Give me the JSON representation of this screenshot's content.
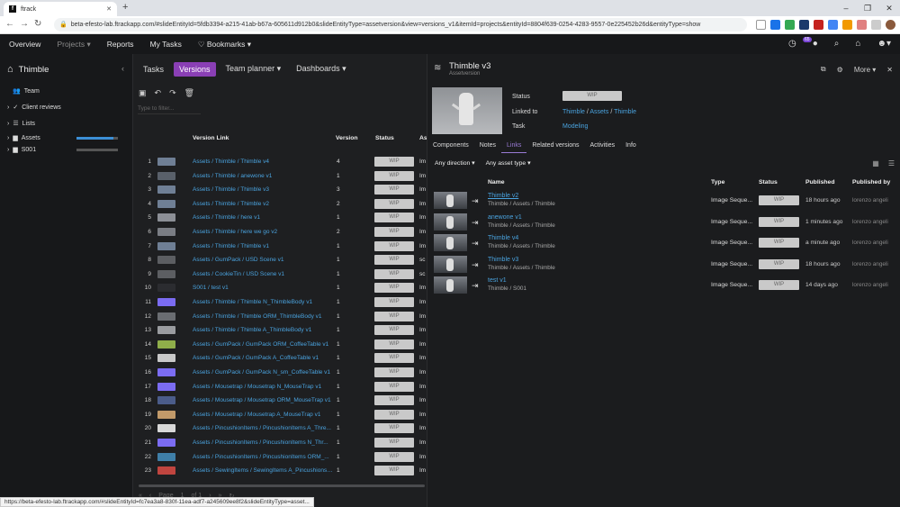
{
  "browser": {
    "tab_title": "ftrack",
    "url": "beta-efesto-lab.ftrackapp.com/#slideEntityId=5fdb3394-a215-41ab-b67a-605611d912b0&slideEntityType=assetversion&view=versions_v1&itemId=projects&entityId=8804f639-0254-4283-9557-0e225452b26d&entityType=show",
    "status_url": "https://beta-efesto-lab.ftrackapp.com/#slideEntityId=fc7ea3a8-830f-11ea-adf7-a245609ee8f2&slideEntityType=asset..."
  },
  "header": {
    "nav": [
      "Overview",
      "Projects",
      "Reports",
      "My Tasks",
      "Bookmarks"
    ],
    "notification_count": "65"
  },
  "sidebar": {
    "project": "Thimble",
    "items": [
      "Team",
      "Client reviews",
      "Lists",
      "Assets",
      "S001"
    ],
    "assets_progress": 0.9,
    "s001_progress": 0.0
  },
  "middle": {
    "tabs": [
      "Tasks",
      "Versions",
      "Team planner",
      "Dashboards"
    ],
    "filter_placeholder": "Type to filter...",
    "columns": {
      "link": "Version Link",
      "version": "Version",
      "status": "Status",
      "as": "As"
    },
    "rows": [
      {
        "n": "1",
        "link": "Assets / Thimble / Thimble v4",
        "v": "4",
        "s": "WIP",
        "a": "Im",
        "c": "#6f7f95"
      },
      {
        "n": "2",
        "link": "Assets / Thimble / anewone v1",
        "v": "1",
        "s": "WIP",
        "a": "Im",
        "c": "#59606a"
      },
      {
        "n": "3",
        "link": "Assets / Thimble / Thimble v3",
        "v": "3",
        "s": "WIP",
        "a": "Im",
        "c": "#6f7f95"
      },
      {
        "n": "4",
        "link": "Assets / Thimble / Thimble v2",
        "v": "2",
        "s": "WIP",
        "a": "Im",
        "c": "#6f7f95"
      },
      {
        "n": "5",
        "link": "Assets / Thimble / here v1",
        "v": "1",
        "s": "WIP",
        "a": "Im",
        "c": "#8c8f96"
      },
      {
        "n": "6",
        "link": "Assets / Thimble / here we go v2",
        "v": "2",
        "s": "WIP",
        "a": "Im",
        "c": "#7a7d84"
      },
      {
        "n": "7",
        "link": "Assets / Thimble / Thimble v1",
        "v": "1",
        "s": "WIP",
        "a": "Im",
        "c": "#6f7f95"
      },
      {
        "n": "8",
        "link": "Assets / GumPack / USD Scene v1",
        "v": "1",
        "s": "WIP",
        "a": "sc",
        "c": "#5c5e62"
      },
      {
        "n": "9",
        "link": "Assets / CookieTin / USD Scene v1",
        "v": "1",
        "s": "WIP",
        "a": "sc",
        "c": "#5c5e62"
      },
      {
        "n": "10",
        "link": "S001 / test v1",
        "v": "1",
        "s": "WIP",
        "a": "Im",
        "c": "#2b2c30"
      },
      {
        "n": "11",
        "link": "Assets / Thimble / Thimble N_ThimbleBody v1",
        "v": "1",
        "s": "WIP",
        "a": "Im",
        "c": "#7b6cf2"
      },
      {
        "n": "12",
        "link": "Assets / Thimble / Thimble ORM_ThimbleBody v1",
        "v": "1",
        "s": "WIP",
        "a": "Im",
        "c": "#6a6d72"
      },
      {
        "n": "13",
        "link": "Assets / Thimble / Thimble A_ThimbleBody v1",
        "v": "1",
        "s": "WIP",
        "a": "Im",
        "c": "#9a9ca0"
      },
      {
        "n": "14",
        "link": "Assets / GumPack / GumPack ORM_CoffeeTable v1",
        "v": "1",
        "s": "WIP",
        "a": "Im",
        "c": "#8fae4a"
      },
      {
        "n": "15",
        "link": "Assets / GumPack / GumPack A_CoffeeTable v1",
        "v": "1",
        "s": "WIP",
        "a": "Im",
        "c": "#c9c9c9"
      },
      {
        "n": "16",
        "link": "Assets / GumPack / GumPack N_sm_CoffeeTable v1",
        "v": "1",
        "s": "WIP",
        "a": "Im",
        "c": "#7b6cf2"
      },
      {
        "n": "17",
        "link": "Assets / Mousetrap / Mousetrap N_MouseTrap v1",
        "v": "1",
        "s": "WIP",
        "a": "Im",
        "c": "#7b6cf2"
      },
      {
        "n": "18",
        "link": "Assets / Mousetrap / Mousetrap ORM_MouseTrap v1",
        "v": "1",
        "s": "WIP",
        "a": "Im",
        "c": "#4b5c8a"
      },
      {
        "n": "19",
        "link": "Assets / Mousetrap / Mousetrap A_MouseTrap v1",
        "v": "1",
        "s": "WIP",
        "a": "Im",
        "c": "#c29a6a"
      },
      {
        "n": "20",
        "link": "Assets / PincushionItems / PincushionItems A_Thre...",
        "v": "1",
        "s": "WIP",
        "a": "Im",
        "c": "#d8d8d8"
      },
      {
        "n": "21",
        "link": "Assets / PincushionItems / PincushionItems N_Thr...",
        "v": "1",
        "s": "WIP",
        "a": "Im",
        "c": "#7b6cf2"
      },
      {
        "n": "22",
        "link": "Assets / PincushionItems / PincushionItems ORM_...",
        "v": "1",
        "s": "WIP",
        "a": "Im",
        "c": "#3f7fa8"
      },
      {
        "n": "23",
        "link": "Assets / SewingItems / SewingItems A_Pincushions ...",
        "v": "1",
        "s": "WIP",
        "a": "Im",
        "c": "#c0453f"
      }
    ],
    "pager": {
      "label": "Page",
      "page": "1",
      "of": "of 1"
    }
  },
  "detail": {
    "title": "Thimble v3",
    "subtitle": "Assetversion",
    "more": "More",
    "status_label": "Status",
    "status_value": "WIP",
    "linked_label": "Linked to",
    "linked": [
      "Thimble",
      "Assets",
      "Thimble"
    ],
    "task_label": "Task",
    "task_value": "Modeling",
    "tabs": [
      "Components",
      "Notes",
      "Links",
      "Related versions",
      "Activities",
      "Info"
    ],
    "filters": [
      "Any direction",
      "Any asset type"
    ],
    "columns": {
      "name": "Name",
      "type": "Type",
      "status": "Status",
      "published": "Published",
      "by": "Published by"
    },
    "links": [
      {
        "name": "Thimble v2",
        "path": "Thimble / Assets / Thimble",
        "type": "Image Seque...",
        "status": "WIP",
        "published": "18 hours ago",
        "by": "lorenzo angeli"
      },
      {
        "name": "anewone v1",
        "path": "Thimble / Assets / Thimble",
        "type": "Image Seque...",
        "status": "WIP",
        "published": "1 minutes ago",
        "by": "lorenzo angeli"
      },
      {
        "name": "Thimble v4",
        "path": "Thimble / Assets / Thimble",
        "type": "Image Seque...",
        "status": "WIP",
        "published": "a minute ago",
        "by": "lorenzo angeli"
      },
      {
        "name": "Thimble v3",
        "path": "Thimble / Assets / Thimble",
        "type": "Image Seque...",
        "status": "WIP",
        "published": "18 hours ago",
        "by": "lorenzo angeli"
      },
      {
        "name": "test v1",
        "path": "Thimble / S001",
        "type": "Image Seque...",
        "status": "WIP",
        "published": "14 days ago",
        "by": "lorenzo angeli"
      }
    ]
  }
}
